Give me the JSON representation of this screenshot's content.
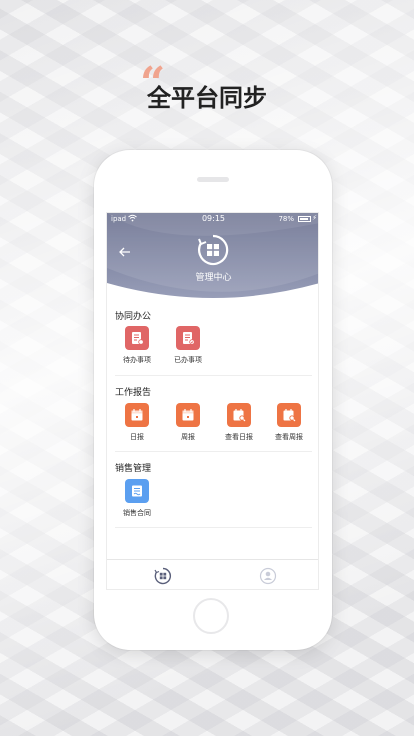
{
  "heading": {
    "quote": "“",
    "title": "全平台同步"
  },
  "status_bar": {
    "carrier": "ipad",
    "time": "09:15",
    "battery": "78%"
  },
  "header": {
    "title": "管理中心"
  },
  "sections": [
    {
      "title": "协同办公",
      "items": [
        {
          "label": "待办事项",
          "color": "#e06666",
          "icon": "todo-doc-icon"
        },
        {
          "label": "已办事项",
          "color": "#e06666",
          "icon": "done-doc-icon"
        }
      ]
    },
    {
      "title": "工作报告",
      "items": [
        {
          "label": "日报",
          "color": "#ee7444",
          "icon": "calendar-icon"
        },
        {
          "label": "周报",
          "color": "#ee7444",
          "icon": "calendar-icon"
        },
        {
          "label": "查看日报",
          "color": "#ee7444",
          "icon": "calendar-search-icon"
        },
        {
          "label": "查看周报",
          "color": "#ee7444",
          "icon": "calendar-search-icon"
        }
      ]
    },
    {
      "title": "销售管理",
      "items": [
        {
          "label": "销售合同",
          "color": "#5b9ff0",
          "icon": "contract-icon"
        }
      ]
    }
  ],
  "tabbar": {
    "items": [
      {
        "icon": "home-grid-icon"
      },
      {
        "icon": "profile-icon"
      }
    ]
  },
  "colors": {
    "header": "#7b809c",
    "accent": "#e06666",
    "report": "#ee7444",
    "sales": "#5b9ff0"
  }
}
